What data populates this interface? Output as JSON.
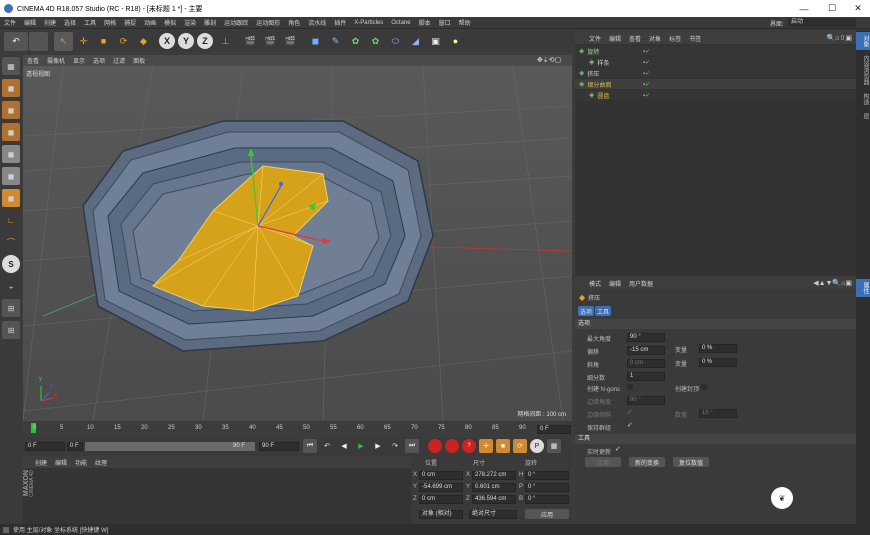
{
  "window": {
    "title": "CINEMA 4D R18.057 Studio (RC - R18) - [未标题 1 *] - 主要"
  },
  "menubar": [
    "文件",
    "编辑",
    "创建",
    "选择",
    "工具",
    "网格",
    "捕捉",
    "动画",
    "模拟",
    "渲染",
    "雕刻",
    "运动跟踪",
    "运动图形",
    "角色",
    "流水线",
    "插件",
    "X-Particles",
    "Octane",
    "脚本",
    "窗口",
    "帮助"
  ],
  "layout_label": "界面:",
  "layout_value": "启动",
  "viewport": {
    "menu": [
      "查看",
      "摄像机",
      "显示",
      "选项",
      "过滤",
      "面板"
    ],
    "name": "透视视图",
    "grid_spacing": "网格间距 : 100 cm",
    "axis_labels": {
      "x": "x",
      "y": "y",
      "z": "z"
    }
  },
  "timeline": {
    "ticks": [
      "0",
      "5",
      "10",
      "15",
      "20",
      "25",
      "30",
      "35",
      "40",
      "45",
      "50",
      "55",
      "60",
      "65",
      "70",
      "75",
      "80",
      "85",
      "90"
    ],
    "end_frame": "0 F"
  },
  "transport": {
    "current": "0 F",
    "start": "0 F",
    "slider_end": "90 F",
    "max": "90 F"
  },
  "material": {
    "menu": [
      "创建",
      "编辑",
      "功能",
      "纹理"
    ],
    "brand_top": "MAXON",
    "brand_bottom": "CINEMA 4D"
  },
  "coords": {
    "headers": [
      "位置",
      "尺寸",
      "旋转"
    ],
    "rows": [
      {
        "axis": "X",
        "pos": "0 cm",
        "size_axis": "X",
        "size": "278.272 cm",
        "rot_axis": "H",
        "rot": "0 °"
      },
      {
        "axis": "Y",
        "pos": "-54.699 cm",
        "size_axis": "Y",
        "size": "0.601 cm",
        "rot_axis": "P",
        "rot": "0 °"
      },
      {
        "axis": "Z",
        "pos": "0 cm",
        "size_axis": "Z",
        "size": "436.594 cm",
        "rot_axis": "B",
        "rot": "0 °"
      }
    ],
    "mode": "对象 (相对)",
    "size_mode": "绝对尺寸",
    "apply": "应用"
  },
  "status": "使用 主层/对象 坐标系统 [快捷键 W]",
  "objects": {
    "menu": [
      "文件",
      "编辑",
      "查看",
      "对象",
      "标签",
      "书签"
    ],
    "items": [
      {
        "name": "旋转",
        "indent": 0,
        "color": "#8fe08f"
      },
      {
        "name": "样条",
        "indent": 1,
        "color": "#cfcfcf"
      },
      {
        "name": "挤压",
        "indent": 0,
        "color": "#cfcfcf"
      },
      {
        "name": "细分曲面",
        "indent": 0,
        "color": "#d6b64a"
      },
      {
        "name": "圆盘",
        "indent": 1,
        "color": "#d6b64a"
      }
    ]
  },
  "attributes": {
    "menu": [
      "模式",
      "编辑",
      "用户数据"
    ],
    "title": "挤压",
    "tabs": [
      "选项",
      "工具"
    ],
    "section_options": "选项",
    "fields": [
      {
        "label": "最大角度",
        "value": "90 °"
      },
      {
        "label": "偏移",
        "value": "-15 cm"
      },
      {
        "label": "斜角",
        "value": "0 cm"
      },
      {
        "label": "细分数",
        "value": "1"
      }
    ],
    "var_label": "变量",
    "var_value1": "0 %",
    "var_value2": "0 %",
    "create_ngons": "创建 N-gons",
    "create_caps": "创建封顶",
    "edge_angle": "边缘角度",
    "edge_angle_value": "90 °",
    "edge_bevel": "边缘倾斜",
    "amount_label": "数值",
    "amount_value": "15 °",
    "keep_groups": "保持群组",
    "section_tool": "工具",
    "realtime": "实时更新",
    "apply_btn": "应用",
    "new_transform": "新的变换",
    "reset": "复位数值"
  },
  "right_tabs": [
    "对象",
    "内容浏览器",
    "构造",
    "层"
  ],
  "attr_right_tab": "属性"
}
